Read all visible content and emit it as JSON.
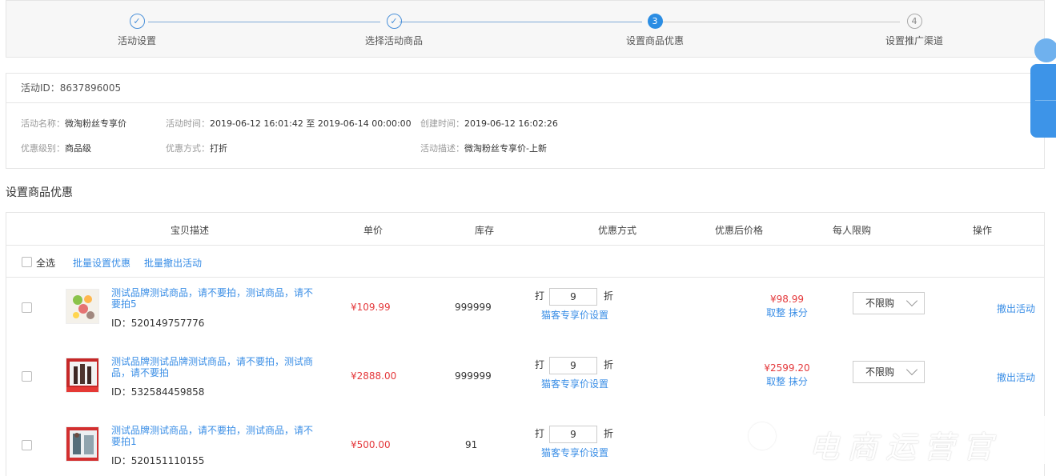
{
  "steps": [
    {
      "label": "活动设置",
      "num": "✓",
      "state": "done"
    },
    {
      "label": "选择活动商品",
      "num": "✓",
      "state": "done"
    },
    {
      "label": "设置商品优惠",
      "num": "3",
      "state": "current"
    },
    {
      "label": "设置推广渠道",
      "num": "4",
      "state": "todo"
    }
  ],
  "info": {
    "id_label": "活动ID：",
    "id_value": "8637896005",
    "name_label": "活动名称：",
    "name_value": "微淘粉丝专享价",
    "time_label": "活动时间：",
    "time_value": "2019-06-12 16:01:42 至 2019-06-14 00:00:00",
    "created_label": "创建时间：",
    "created_value": "2019-06-12 16:02:26",
    "level_label": "优惠级别：",
    "level_value": "商品级",
    "method_label": "优惠方式：",
    "method_value": "打折",
    "desc_label": "活动描述：",
    "desc_value": "微淘粉丝专享价-上新"
  },
  "section_title": "设置商品优惠",
  "table": {
    "headers": {
      "desc": "宝贝描述",
      "price": "单价",
      "stock": "库存",
      "method": "优惠方式",
      "final": "优惠后价格",
      "limit": "每人限购",
      "action": "操作"
    },
    "select_all": "全选",
    "batch_set": "批量设置优惠",
    "batch_remove": "批量撤出活动",
    "rows": [
      {
        "title": "测试品牌测试商品，请不要拍，测试商品，请不要拍5",
        "id": "ID：520149757776",
        "price": "¥109.99",
        "stock": "999999",
        "discount_prefix": "打",
        "discount": "9",
        "discount_unit": "折",
        "discount_link": "猫客专享价设置",
        "final": "¥98.99",
        "round": "取整",
        "erase": "抹分",
        "limit": "不限购",
        "action": "撤出活动"
      },
      {
        "title": "测试品牌测试品牌测试商品，请不要拍，测试商品，请不要拍",
        "id": "ID：532584459858",
        "price": "¥2888.00",
        "stock": "999999",
        "discount_prefix": "打",
        "discount": "9",
        "discount_unit": "折",
        "discount_link": "猫客专享价设置",
        "final": "¥2599.20",
        "round": "取整",
        "erase": "抹分",
        "limit": "不限购",
        "action": "撤出活动"
      },
      {
        "title": "测试品牌测试商品，请不要拍，测试商品，请不要拍1",
        "id": "ID：520151110155",
        "price": "¥500.00",
        "stock": "91",
        "discount_prefix": "打",
        "discount": "9",
        "discount_unit": "折",
        "discount_link": "猫客专享价设置"
      }
    ]
  },
  "watermark": "电商运营官",
  "colors": {
    "accent": "#3a8ee6",
    "price": "#e4393c",
    "step_current": "#2b8de3"
  }
}
